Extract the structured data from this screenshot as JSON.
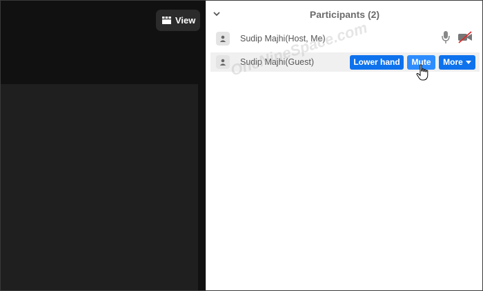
{
  "toolbar": {
    "view_label": "View"
  },
  "panel": {
    "title": "Participants (2)",
    "participants": [
      {
        "name": "Sudip Majhi(Host, Me)"
      },
      {
        "name": "Sudip Majhi(Guest)"
      }
    ]
  },
  "actions": {
    "lower_hand": "Lower hand",
    "mute": "Mute",
    "more": "More"
  },
  "watermark": "OneNineSpace.com",
  "colors": {
    "primary_button": "#0e72ed",
    "hover_button": "#2d8cff",
    "video_off_red": "#e02828"
  }
}
